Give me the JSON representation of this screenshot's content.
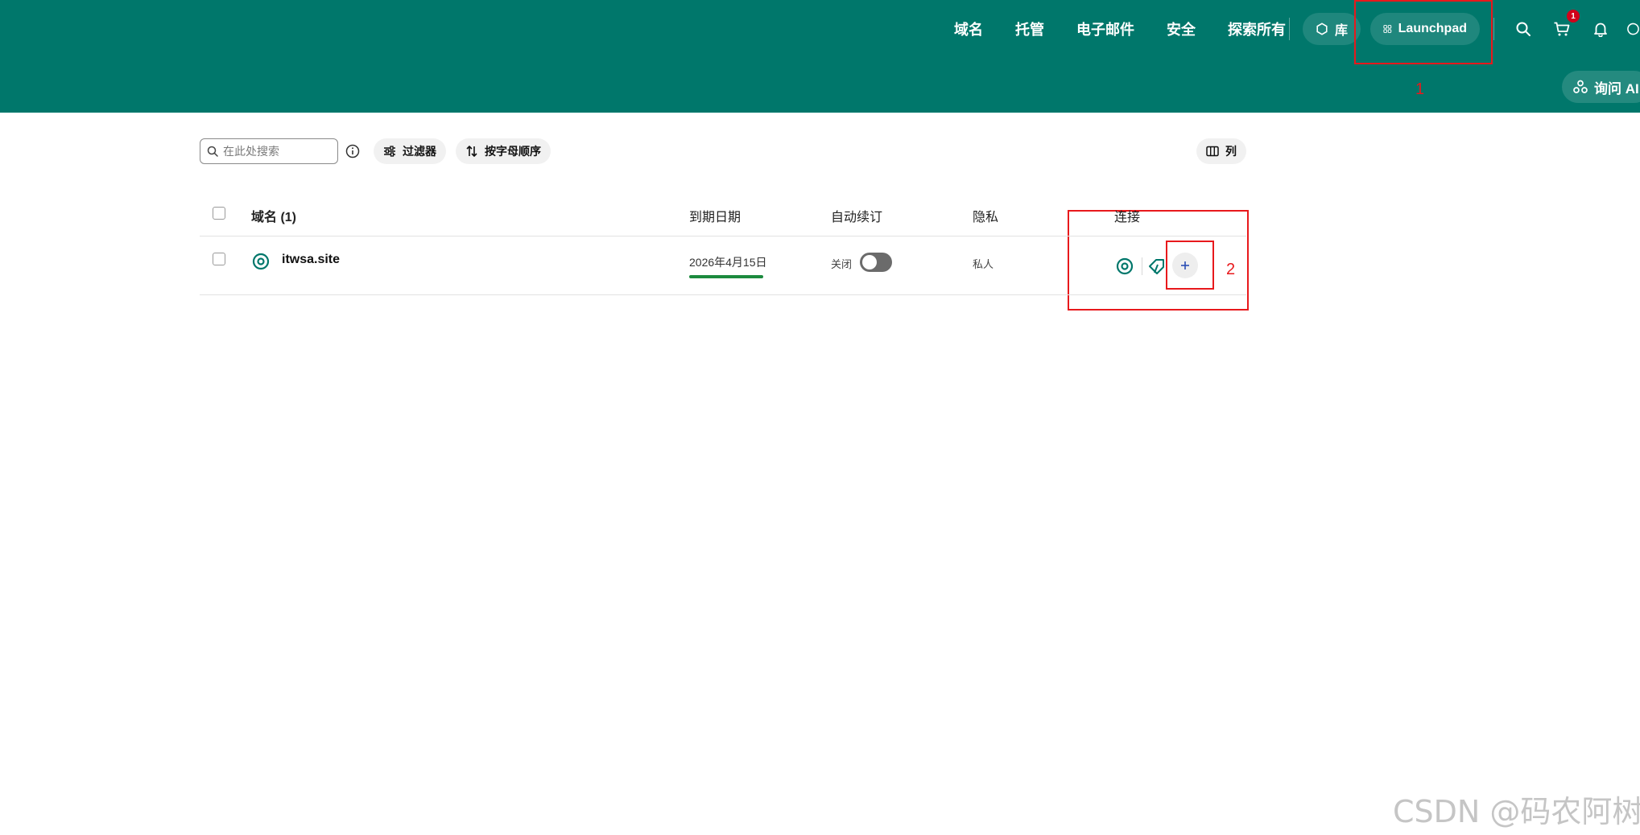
{
  "header": {
    "nav": [
      "域名",
      "托管",
      "电子邮件",
      "安全",
      "探索所有"
    ],
    "library_label": "库",
    "launchpad_label": "Launchpad",
    "cart_count": "1",
    "ai_label": "询问 AI",
    "icons": [
      "library-icon",
      "launchpad-grid-icon",
      "search-icon",
      "cart-icon",
      "bell-icon",
      "help-icon",
      "ai-icon"
    ]
  },
  "toolbar": {
    "search_placeholder": "在此处搜索",
    "filter_label": "过滤器",
    "sort_label": "按字母顺序",
    "columns_label": "列"
  },
  "table": {
    "headers": {
      "domain": "域名 (1)",
      "expiry": "到期日期",
      "auto_renew": "自动续订",
      "privacy": "隐私",
      "connect": "连接"
    },
    "rows": [
      {
        "domain": "itwsa.site",
        "expiry": "2026年4月15日",
        "auto_renew_label": "关闭",
        "auto_renew_on": false,
        "privacy": "私人"
      }
    ]
  },
  "annotations": {
    "box1_label": "1",
    "box2_label": "2",
    "color": "#e8191c"
  },
  "colors": {
    "brand": "#00776b",
    "expiry_bar": "#1b8a3e"
  },
  "watermark": "CSDN @码农阿树"
}
